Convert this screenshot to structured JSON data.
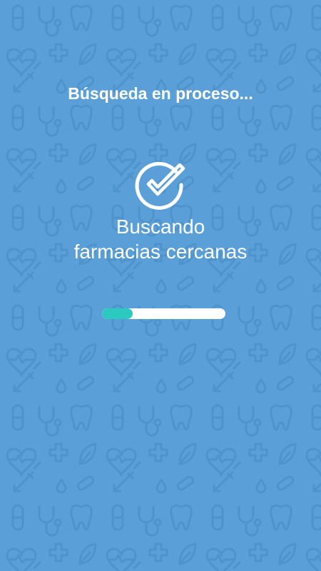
{
  "screen": {
    "title": "Búsqueda en proceso...",
    "message_line1": "Buscando",
    "message_line2": "farmacias cercanas"
  },
  "progress": {
    "value": 0.25
  },
  "icons": {
    "status": "check-circle-icon"
  },
  "colors": {
    "background": "#5b9fd8",
    "pattern": "#4f93cd",
    "text": "#ffffff",
    "progress_track": "#ffffff",
    "progress_fill": "#2cc9c0"
  }
}
